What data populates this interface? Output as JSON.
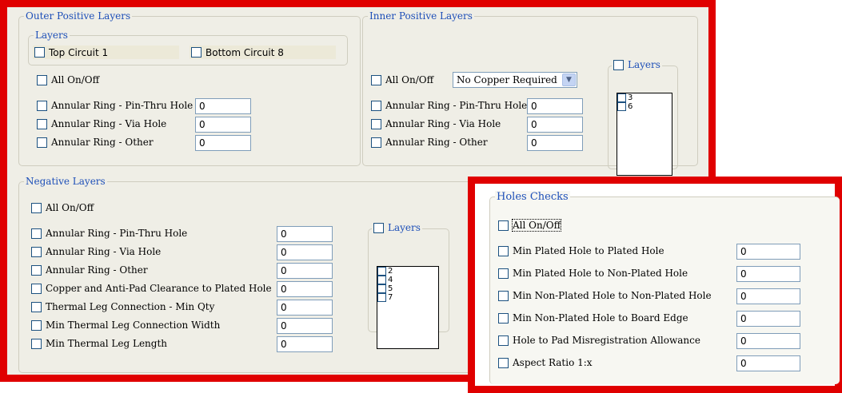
{
  "outer_positive": {
    "title": "Outer Positive Layers",
    "layers_title": "Layers",
    "top_layer": "Top Circuit 1",
    "bottom_layer": "Bottom Circuit 8",
    "all_onoff": "All On/Off",
    "rows": [
      {
        "label": "Annular Ring - Pin-Thru Hole",
        "value": "0"
      },
      {
        "label": "Annular Ring - Via Hole",
        "value": "0"
      },
      {
        "label": "Annular Ring - Other",
        "value": "0"
      }
    ]
  },
  "inner_positive": {
    "title": "Inner Positive Layers",
    "all_onoff": "All On/Off",
    "copper_option": "No Copper Required",
    "layers_title": "Layers",
    "layers": [
      "3",
      "6"
    ],
    "rows": [
      {
        "label": "Annular Ring - Pin-Thru Hole",
        "value": "0"
      },
      {
        "label": "Annular Ring - Via Hole",
        "value": "0"
      },
      {
        "label": "Annular Ring - Other",
        "value": "0"
      }
    ]
  },
  "negative": {
    "title": "Negative Layers",
    "all_onoff": "All On/Off",
    "layers_title": "Layers",
    "layers": [
      "2",
      "4",
      "5",
      "7"
    ],
    "rows": [
      {
        "label": "Annular Ring - Pin-Thru Hole",
        "value": "0"
      },
      {
        "label": "Annular Ring - Via Hole",
        "value": "0"
      },
      {
        "label": "Annular Ring - Other",
        "value": "0"
      },
      {
        "label": "Copper and Anti-Pad Clearance to Plated Hole",
        "value": "0"
      },
      {
        "label": "Thermal  Leg Connection - Min Qty",
        "value": "0"
      },
      {
        "label": "Min Thermal Leg Connection Width",
        "value": "0"
      },
      {
        "label": "Min Thermal Leg Length",
        "value": "0"
      }
    ]
  },
  "holes": {
    "title": "Holes Checks",
    "all_onoff": "All On/Off",
    "rows": [
      {
        "label": "Min Plated Hole to Plated Hole",
        "value": "0"
      },
      {
        "label": "Min Plated Hole to Non-Plated Hole",
        "value": "0"
      },
      {
        "label": "Min Non-Plated Hole to Non-Plated Hole",
        "value": "0"
      },
      {
        "label": "Min Non-Plated Hole to Board Edge",
        "value": "0"
      },
      {
        "label": "Hole to Pad Misregistration Allowance",
        "value": "0"
      },
      {
        "label": "Aspect Ratio 1:x",
        "value": "0"
      }
    ]
  },
  "colors": {
    "highlight_border": "#e00000",
    "group_title": "#1d4fb8",
    "panel_bg": "#efeee6"
  }
}
